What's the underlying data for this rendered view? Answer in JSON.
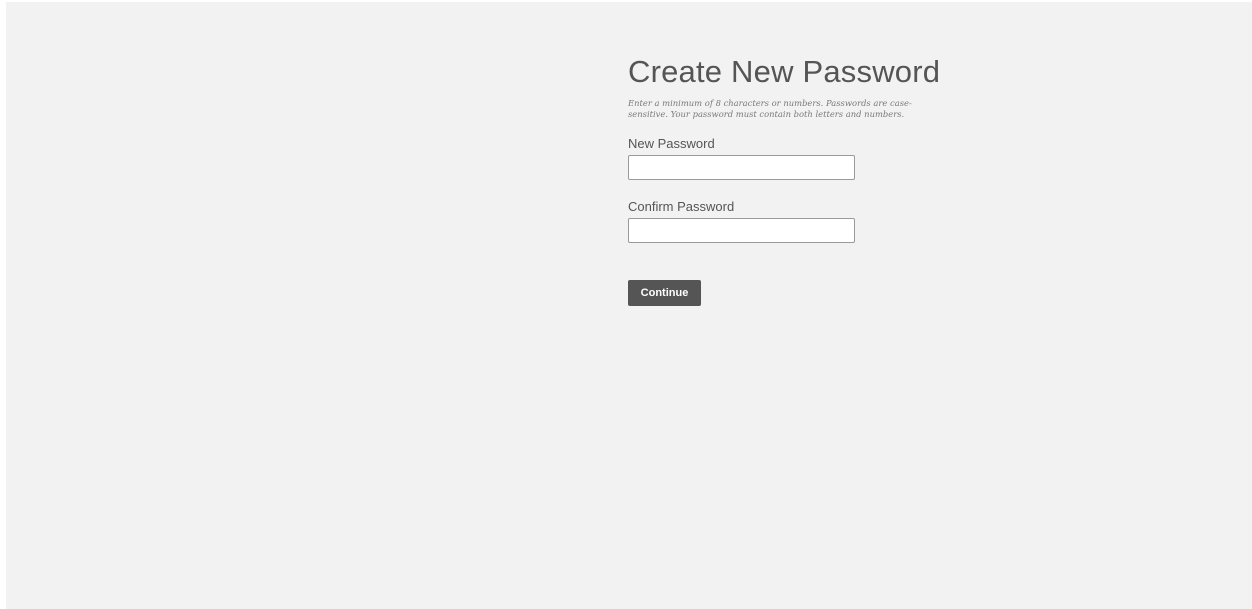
{
  "form": {
    "title": "Create New Password",
    "hint": "Enter a minimum of 8 characters or numbers. Passwords are case-sensitive. Your password must contain both letters and numbers.",
    "new_password": {
      "label": "New Password",
      "value": "",
      "placeholder": ""
    },
    "confirm_password": {
      "label": "Confirm Password",
      "value": "",
      "placeholder": ""
    },
    "continue_label": "Continue"
  },
  "colors": {
    "page_background": "#f2f2f2",
    "title_text": "#555555",
    "hint_text": "#7a7a7a",
    "button_background": "#555555",
    "button_text": "#ffffff"
  }
}
